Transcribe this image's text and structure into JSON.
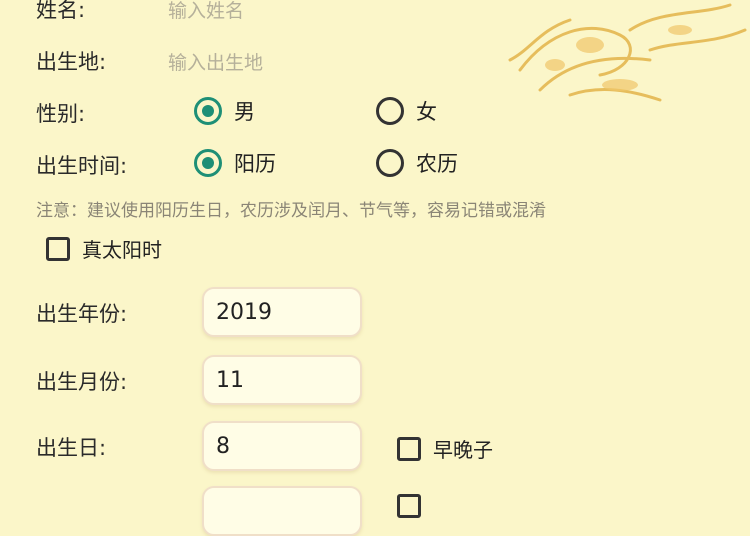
{
  "form": {
    "name": {
      "label": "姓名:",
      "placeholder": "输入姓名"
    },
    "birthplace": {
      "label": "出生地:",
      "placeholder": "输入出生地"
    },
    "gender": {
      "label": "性别:",
      "options": [
        {
          "label": "男",
          "selected": true
        },
        {
          "label": "女",
          "selected": false
        }
      ]
    },
    "birth_time": {
      "label": "出生时间:",
      "options": [
        {
          "label": "阳历",
          "selected": true
        },
        {
          "label": "农历",
          "selected": false
        }
      ]
    },
    "note": "注意：建议使用阳历生日，农历涉及闰月、节气等，容易记错或混淆",
    "true_solar_time": {
      "label": "真太阳时",
      "checked": false
    },
    "birth_year": {
      "label": "出生年份:",
      "value": "2019"
    },
    "birth_month": {
      "label": "出生月份:",
      "value": "11"
    },
    "birth_day": {
      "label": "出生日:",
      "value": "8"
    },
    "early_late_zi": {
      "label": "早晚子",
      "checked": false
    }
  },
  "colors": {
    "background": "#fbf6c9",
    "accent": "#1e8f76"
  },
  "decor": {
    "icon": "phoenix-icon"
  }
}
